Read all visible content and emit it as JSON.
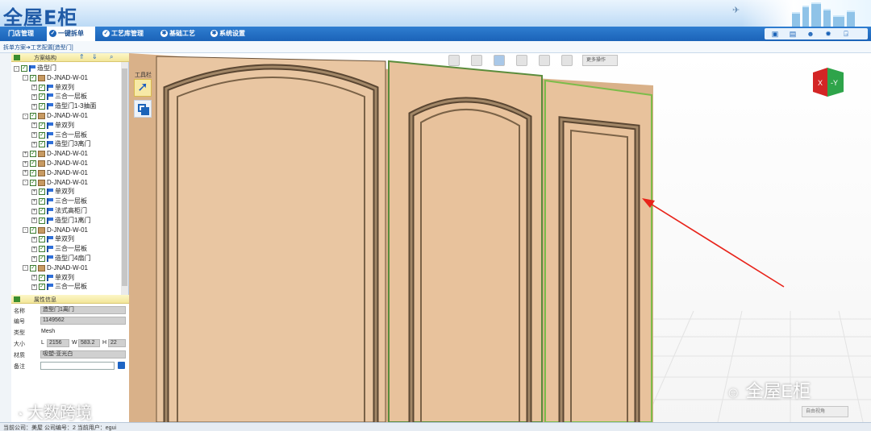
{
  "app": {
    "logo_text": "全屋E柜"
  },
  "nav": {
    "items": [
      {
        "label": "门店管理",
        "active": false,
        "icon": "store-icon"
      },
      {
        "label": "一键拆单",
        "active": true,
        "icon": "check-circle-icon"
      },
      {
        "label": "工艺库管理",
        "active": false,
        "icon": "check-circle-icon"
      },
      {
        "label": "基础工艺",
        "active": false,
        "icon": "gear-circle-icon"
      },
      {
        "label": "系统设置",
        "active": false,
        "icon": "gear-circle-icon"
      }
    ],
    "tools": [
      "monitor-icon",
      "calendar-icon",
      "user-icon",
      "settings-icon",
      "logout-icon"
    ]
  },
  "breadcrumb": "拆单方案➔工艺配置[造型门]",
  "tree_panel": {
    "title": "方案结构",
    "rows": [
      {
        "level": 0,
        "expander": "-",
        "icon": "flag",
        "label": "造型门"
      },
      {
        "level": 1,
        "expander": "-",
        "icon": "box",
        "label": "D-JNAD-W-01"
      },
      {
        "level": 2,
        "expander": "+",
        "icon": "flag",
        "label": "单双列"
      },
      {
        "level": 2,
        "expander": "+",
        "icon": "flag",
        "label": "三合一层板"
      },
      {
        "level": 2,
        "expander": "+",
        "icon": "flag",
        "label": "造型门1-3抽面"
      },
      {
        "level": 1,
        "expander": "-",
        "icon": "box",
        "label": "D-JNAD-W-01"
      },
      {
        "level": 2,
        "expander": "+",
        "icon": "flag",
        "label": "单双列"
      },
      {
        "level": 2,
        "expander": "+",
        "icon": "flag",
        "label": "三合一层板"
      },
      {
        "level": 2,
        "expander": "+",
        "icon": "flag",
        "label": "造型门3离门"
      },
      {
        "level": 1,
        "expander": "+",
        "icon": "box",
        "label": "D-JNAD-W-01"
      },
      {
        "level": 1,
        "expander": "+",
        "icon": "box",
        "label": "D-JNAD-W-01"
      },
      {
        "level": 1,
        "expander": "+",
        "icon": "box",
        "label": "D-JNAD-W-01"
      },
      {
        "level": 1,
        "expander": "-",
        "icon": "box",
        "label": "D-JNAD-W-01"
      },
      {
        "level": 2,
        "expander": "+",
        "icon": "flag",
        "label": "单双列"
      },
      {
        "level": 2,
        "expander": "+",
        "icon": "flag",
        "label": "三合一层板"
      },
      {
        "level": 2,
        "expander": "+",
        "icon": "flag",
        "label": "法式高柜门"
      },
      {
        "level": 2,
        "expander": "+",
        "icon": "flag",
        "label": "造型门1离门"
      },
      {
        "level": 1,
        "expander": "-",
        "icon": "box",
        "label": "D-JNAD-W-01"
      },
      {
        "level": 2,
        "expander": "+",
        "icon": "flag",
        "label": "单双列"
      },
      {
        "level": 2,
        "expander": "+",
        "icon": "flag",
        "label": "三合一层板"
      },
      {
        "level": 2,
        "expander": "+",
        "icon": "flag",
        "label": "造型门4扇门"
      },
      {
        "level": 1,
        "expander": "-",
        "icon": "box",
        "label": "D-JNAD-W-01"
      },
      {
        "level": 2,
        "expander": "+",
        "icon": "flag",
        "label": "单双列"
      },
      {
        "level": 2,
        "expander": "+",
        "icon": "flag",
        "label": "三合一层板"
      }
    ]
  },
  "props_panel": {
    "title": "属性信息",
    "name_label": "名称",
    "name_value": "造型门1离门",
    "code_label": "编号",
    "code_value": "1149562",
    "type_label": "类型",
    "type_value": "Mesh",
    "size_label": "大小",
    "l_label": "L",
    "l_value": "2156",
    "w_label": "W",
    "w_value": "583.2",
    "h_label": "H",
    "h_value": "22",
    "material_label": "材质",
    "material_value": "吸塑-亚光白",
    "note_label": "备注",
    "note_value": ""
  },
  "viewport": {
    "toolbox_title": "工具栏",
    "more_ops": "更多操作",
    "view_select": "自由视角",
    "axis_x": "X",
    "axis_y": "-Y",
    "watermark": "全屋E柜"
  },
  "watermark_left": "大数跨境",
  "status": "当前公司：美屋   公司编号：2   当前用户：egui",
  "colors": {
    "nav_bg": "#1b63b8",
    "door": "#e5c19b",
    "highlight": "#a5d36b",
    "arrow": "#e8231a"
  }
}
